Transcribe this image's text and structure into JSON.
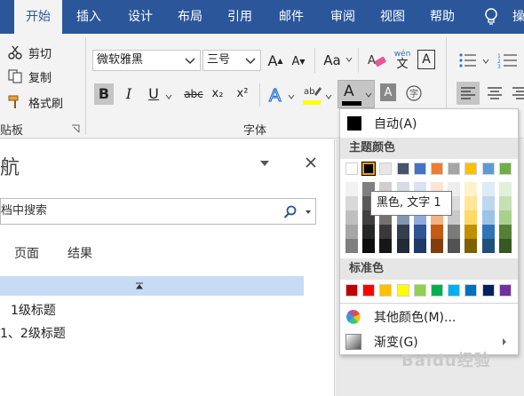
{
  "tabs": [
    {
      "label": "开始",
      "active": true
    },
    {
      "label": "插入"
    },
    {
      "label": "设计"
    },
    {
      "label": "布局"
    },
    {
      "label": "引用"
    },
    {
      "label": "邮件"
    },
    {
      "label": "审阅"
    },
    {
      "label": "视图"
    },
    {
      "label": "帮助"
    },
    {
      "label": "操"
    }
  ],
  "clipboard": {
    "cut": "剪切",
    "copy": "复制",
    "format_painter": "格式刷",
    "group_label": "贴板"
  },
  "font": {
    "family": "微软雅黑",
    "size": "三号",
    "group_label": "字体",
    "bold": "B",
    "italic": "I",
    "underline": "U",
    "strike": "abc",
    "subscript": "x₂",
    "superscript": "x²",
    "grow": "A",
    "shrink": "A",
    "case": "Aa",
    "font_color_letter": "A",
    "wen": "wén",
    "wen_char": "文",
    "font_color_bar": "#000000",
    "highlight_bar": "#ffff00"
  },
  "nav_pane": {
    "title": "航",
    "search_placeholder": "档中搜索",
    "tabs": [
      "页面",
      "结果"
    ],
    "headings": [
      "1级标题",
      "1、2级标题"
    ]
  },
  "color_menu": {
    "auto_label": "自动(A)",
    "theme_label": "主题颜色",
    "standard_label": "标准色",
    "more_colors": "其他颜色(M)...",
    "gradient": "渐变(G)",
    "tooltip": "黑色, 文字 1",
    "auto_color": "#000000",
    "theme_top_row": [
      "#ffffff",
      "#000000",
      "#e7e6e6",
      "#44546a",
      "#4472c4",
      "#ed7d31",
      "#a5a5a5",
      "#ffc000",
      "#5b9bd5",
      "#70ad47"
    ],
    "theme_shades": [
      [
        "#f2f2f2",
        "#808080",
        "#d0cece",
        "#d6dce5",
        "#d9e2f3",
        "#fbe5d6",
        "#ededed",
        "#fff2cc",
        "#deebf7",
        "#e2f0d9"
      ],
      [
        "#d9d9d9",
        "#595959",
        "#aeabab",
        "#adb9ca",
        "#b4c7e7",
        "#f8cbad",
        "#dbdbdb",
        "#ffe699",
        "#bdd7ee",
        "#c5e0b4"
      ],
      [
        "#bfbfbf",
        "#404040",
        "#767171",
        "#8497b0",
        "#8faadc",
        "#f4b183",
        "#c9c9c9",
        "#ffd966",
        "#9dc3e6",
        "#a9d18e"
      ],
      [
        "#a6a6a6",
        "#262626",
        "#3b3838",
        "#333f50",
        "#2f5597",
        "#c55a11",
        "#7b7b7b",
        "#bf9000",
        "#2e75b6",
        "#548235"
      ],
      [
        "#7f7f7f",
        "#0d0d0d",
        "#171616",
        "#222a35",
        "#1f3864",
        "#843c0c",
        "#525252",
        "#7f6000",
        "#1f4e79",
        "#385723"
      ]
    ],
    "standard_colors": [
      "#c00000",
      "#ff0000",
      "#ffc000",
      "#ffff00",
      "#92d050",
      "#00b050",
      "#00b0f0",
      "#0070c0",
      "#002060",
      "#7030a0"
    ]
  },
  "watermark": "Baidu经验"
}
